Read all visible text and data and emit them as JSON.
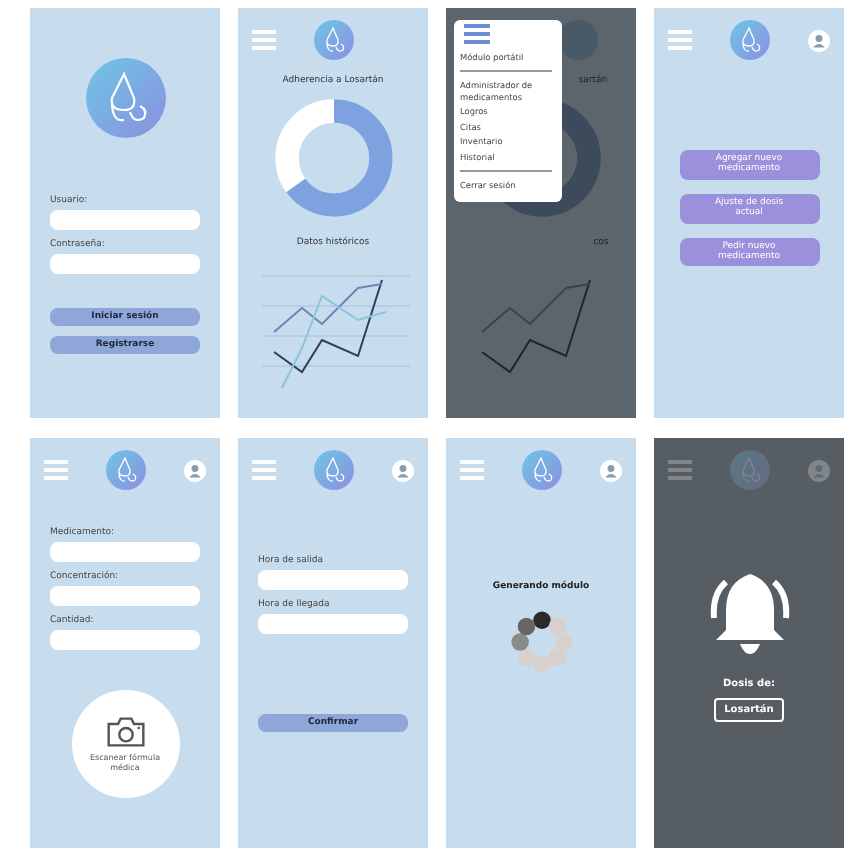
{
  "screens": [
    {
      "kind": "login",
      "fields": [
        {
          "label": "Usuario:"
        },
        {
          "label": "Contraseña:"
        }
      ],
      "buttons": [
        "Iniciar sesión",
        "Registrarse"
      ]
    },
    {
      "kind": "adherence",
      "header": {
        "profile": false
      },
      "title": "Adherencia a Losartán",
      "level": 0.65,
      "chart_title": "Datos históricos"
    },
    {
      "kind": "menu",
      "menu_groups": [
        [
          "Módulo portátil"
        ],
        [
          "Administrador de medicamentos",
          "Logros",
          "Citas",
          "Inventario",
          "Historial"
        ],
        [
          "Cerrar sesión"
        ]
      ],
      "title_visible": "sartán",
      "chart_title_visible": "cos"
    },
    {
      "kind": "actions",
      "header": {
        "profile": true
      },
      "buttons": [
        "Agregar nuevo medicamento",
        "Ajuste de dosis actual",
        "Pedir nuevo medicamento"
      ]
    },
    {
      "kind": "form",
      "header": {
        "profile": true
      },
      "fields": [
        {
          "label": "Medicamento:"
        },
        {
          "label": "Concentración:"
        },
        {
          "label": "Cantidad:"
        }
      ],
      "scan_label": "Escanear fórmula médica"
    },
    {
      "kind": "form",
      "header": {
        "profile": true
      },
      "fields": [
        {
          "label": "Hora de salida"
        },
        {
          "label": "Hora de llegada"
        }
      ],
      "confirm": "Confirmar"
    },
    {
      "kind": "loading",
      "header": {
        "profile": true
      },
      "title": "Generando módulo"
    },
    {
      "kind": "alert",
      "header": {
        "profile": true
      },
      "label": "Dosis de:",
      "medicine": "Losartán"
    }
  ]
}
